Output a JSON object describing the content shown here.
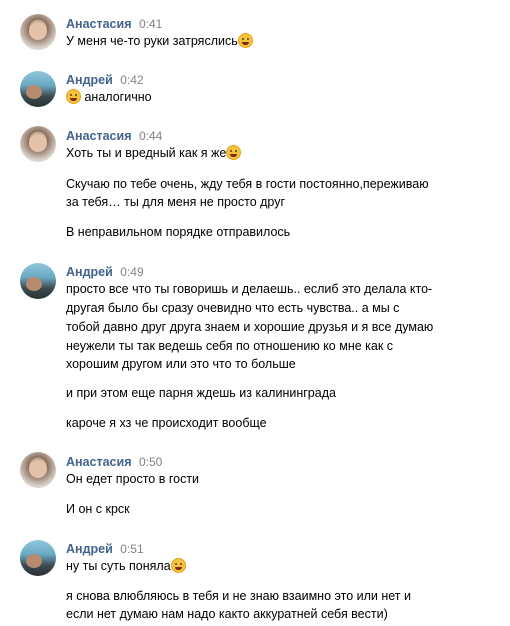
{
  "messages": [
    {
      "author": "Анастасия",
      "time": "0:41",
      "lines": [
        "У меня че-то руки затряслись"
      ]
    },
    {
      "author": "Андрей",
      "time": "0:42",
      "lines": [
        "аналогично"
      ]
    },
    {
      "author": "Анастасия",
      "time": "0:44",
      "lines": [
        "Хоть ты и вредный как я же",
        "Скучаю по тебе очень, жду тебя в гости постоянно,переживаю",
        "за тебя… ты для меня не просто друг",
        "В неправильном порядке отправилось"
      ]
    },
    {
      "author": "Андрей",
      "time": "0:49",
      "lines": [
        "просто все что ты говоришь и делаешь.. еслиб это делала кто-",
        "другая было бы сразу очевидно что есть чувства.. а мы с",
        "тобой давно друг друга знаем и хорошие друзья и я все думаю",
        "неужели ты так ведешь себя по отношению ко мне как с",
        "хорошим другом или это что то больше",
        "и при этом еще парня ждешь из калининграда",
        "кароче я хз че происходит вообще"
      ]
    },
    {
      "author": "Анастасия",
      "time": "0:50",
      "lines": [
        "Он едет просто в гости",
        "И он с крск"
      ]
    },
    {
      "author": "Андрей",
      "time": "0:51",
      "lines": [
        "ну ты суть поняла",
        "я снова влюбляюсь в тебя и не знаю взаимно это или нет и",
        "если нет думаю нам надо както аккуратней себя вести)"
      ]
    }
  ]
}
